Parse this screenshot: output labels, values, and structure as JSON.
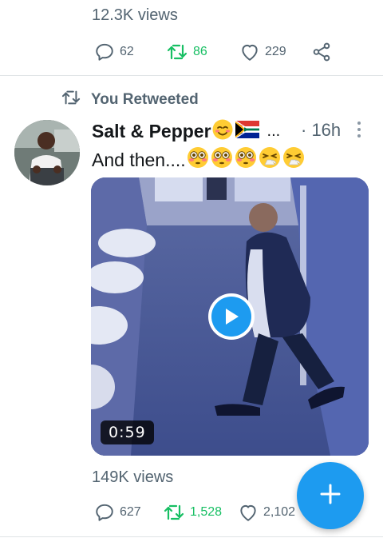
{
  "previous_tweet": {
    "views": "12.3K views",
    "actions": {
      "reply_count": "62",
      "retweet_count": "86",
      "like_count": "229"
    }
  },
  "retweet_header": {
    "label": "You Retweeted"
  },
  "tweet": {
    "author_name": "Salt & Pepper",
    "author_emojis": [
      "smiling-blush-emoji",
      "south-africa-flag-emoji"
    ],
    "truncation": "...",
    "time": "· 16h",
    "text": "And then....",
    "text_emojis": [
      "flushed-face-emoji",
      "flushed-face-emoji",
      "flushed-face-emoji",
      "sneezing-face-emoji",
      "sneezing-face-emoji"
    ],
    "video": {
      "duration": "0:59"
    },
    "views": "149K views",
    "actions": {
      "reply_count": "627",
      "retweet_count": "1,528",
      "like_count": "2,102"
    }
  },
  "colors": {
    "accent": "#1d9bf0",
    "retweet_green": "#17bf63",
    "muted_text": "#536471"
  },
  "fab": {
    "icon": "plus-icon"
  }
}
